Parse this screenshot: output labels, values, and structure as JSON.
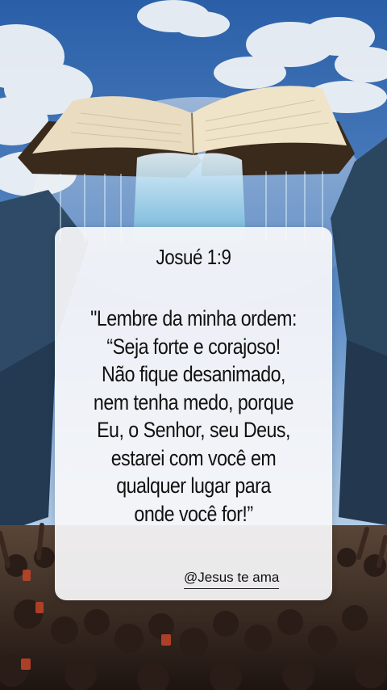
{
  "card": {
    "reference": "Josué 1:9",
    "verse_lines": [
      "\"Lembre da minha ordem:",
      "“Seja forte e corajoso!",
      "Não fique desanimado,",
      "nem tenha medo, porque",
      "Eu, o Senhor, seu Deus,",
      "estarei com você em",
      "qualquer lugar para",
      "onde você for!”"
    ],
    "signature": "@Jesus te ama"
  },
  "colors": {
    "sky_top": "#2a5fa8",
    "sky_bottom": "#bcd3ea",
    "cloud": "#f4f6f8",
    "mountain": "#2e4a66",
    "book_page": "#e9dcc0",
    "book_cover": "#3a2a1c",
    "waterfall": "#bfe6f5",
    "crowd": "#3b2a22",
    "card_background": "#f8f8fa",
    "text": "#111111"
  }
}
